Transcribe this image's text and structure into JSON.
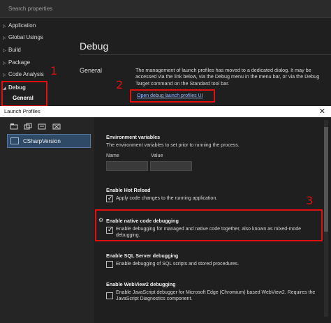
{
  "search": {
    "placeholder": "Search properties"
  },
  "nav": {
    "items": [
      {
        "label": "Application"
      },
      {
        "label": "Global Usings"
      },
      {
        "label": "Build"
      },
      {
        "label": "Package"
      },
      {
        "label": "Code Analysis"
      },
      {
        "label": "Debug"
      },
      {
        "label": "General"
      }
    ]
  },
  "main": {
    "title": "Debug",
    "section_label": "General",
    "description": "The management of launch profiles has moved to a dedicated dialog. It may be accessed via the link below, via the Debug menu in the menu bar, or via the Debug Target command on the Standard tool bar.",
    "link": "Open debug launch profiles UI"
  },
  "annotations": {
    "one": "1",
    "two": "2",
    "three": "3",
    "color": "#e01010"
  },
  "dialog": {
    "title": "Launch Profiles",
    "close": "✕",
    "profile": "CSharpVersion",
    "env": {
      "title": "Environment variables",
      "desc": "The environment variables to set prior to running the process.",
      "col_name": "Name",
      "col_value": "Value"
    },
    "hot_reload": {
      "title": "Enable Hot Reload",
      "desc": "Apply code changes to the running application.",
      "checked": true
    },
    "native": {
      "title": "Enable native code debugging",
      "desc": "Enable debugging for managed and native code together, also known as mixed-mode debugging.",
      "checked": true
    },
    "sql": {
      "title": "Enable SQL Server debugging",
      "desc": "Enable debugging of SQL scripts and stored procedures.",
      "checked": false
    },
    "webview": {
      "title": "Enable WebView2 debugging",
      "desc": "Enable JavaScript debugger for Microsoft Edge (Chromium) based WebView2. Requires the JavaScript Diagnostics component.",
      "checked": false
    }
  }
}
